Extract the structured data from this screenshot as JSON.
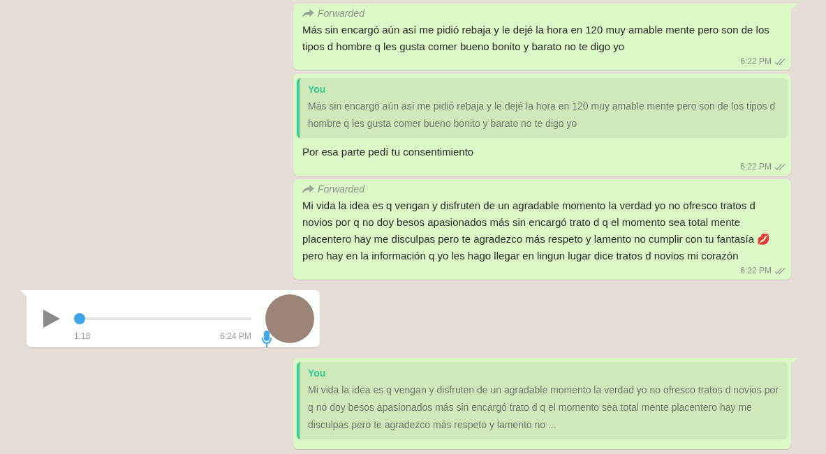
{
  "messages": [
    {
      "kind": "forwarded",
      "tail": true,
      "label": "Forwarded",
      "text": "Más sin encargó aún así me pidió rebaja y le dejé la hora en 120 muy amable mente pero son de los tipos d hombre q les gusta comer bueno bonito y barato no te digo yo",
      "time": "6:22 PM"
    },
    {
      "kind": "reply",
      "tail": false,
      "quote_author": "You",
      "quote_text": "Más sin encargó aún así me pidió rebaja y le dejé la hora en 120 muy amable mente pero son de los tipos d hombre q les gusta comer bueno bonito y barato no te digo yo",
      "text": "Por esa parte pedí tu consentimiento",
      "time": "6:22 PM"
    },
    {
      "kind": "forwarded",
      "tail": false,
      "label": "Forwarded",
      "text": "Mi vida la idea es q vengan y disfruten de un agradable momento la verdad yo no ofresco tratos d novios por q no doy besos apasionados más sin encargó trato d q el momento sea total mente placentero hay me disculpas pero te agradezco más respeto y lamento no cumplir con tu fantasía 💋 pero hay en la información q yo les hago llegar en lingun lugar dice tratos d novios mi corazón",
      "time": "6:22 PM"
    },
    {
      "kind": "voice",
      "tail": true,
      "level": 0,
      "duration": "1:18",
      "time": "6:24 PM"
    },
    {
      "kind": "reply",
      "tail": true,
      "quote_author": "You",
      "quote_text": "Mi vida la idea es q vengan y disfruten de un agradable momento la verdad yo no ofresco tratos d novios por q no doy besos apasionados más sin encargó trato d q el momento sea total mente placentero hay me disculpas pero te agradezco más respeto y lamento no ..."
    }
  ]
}
